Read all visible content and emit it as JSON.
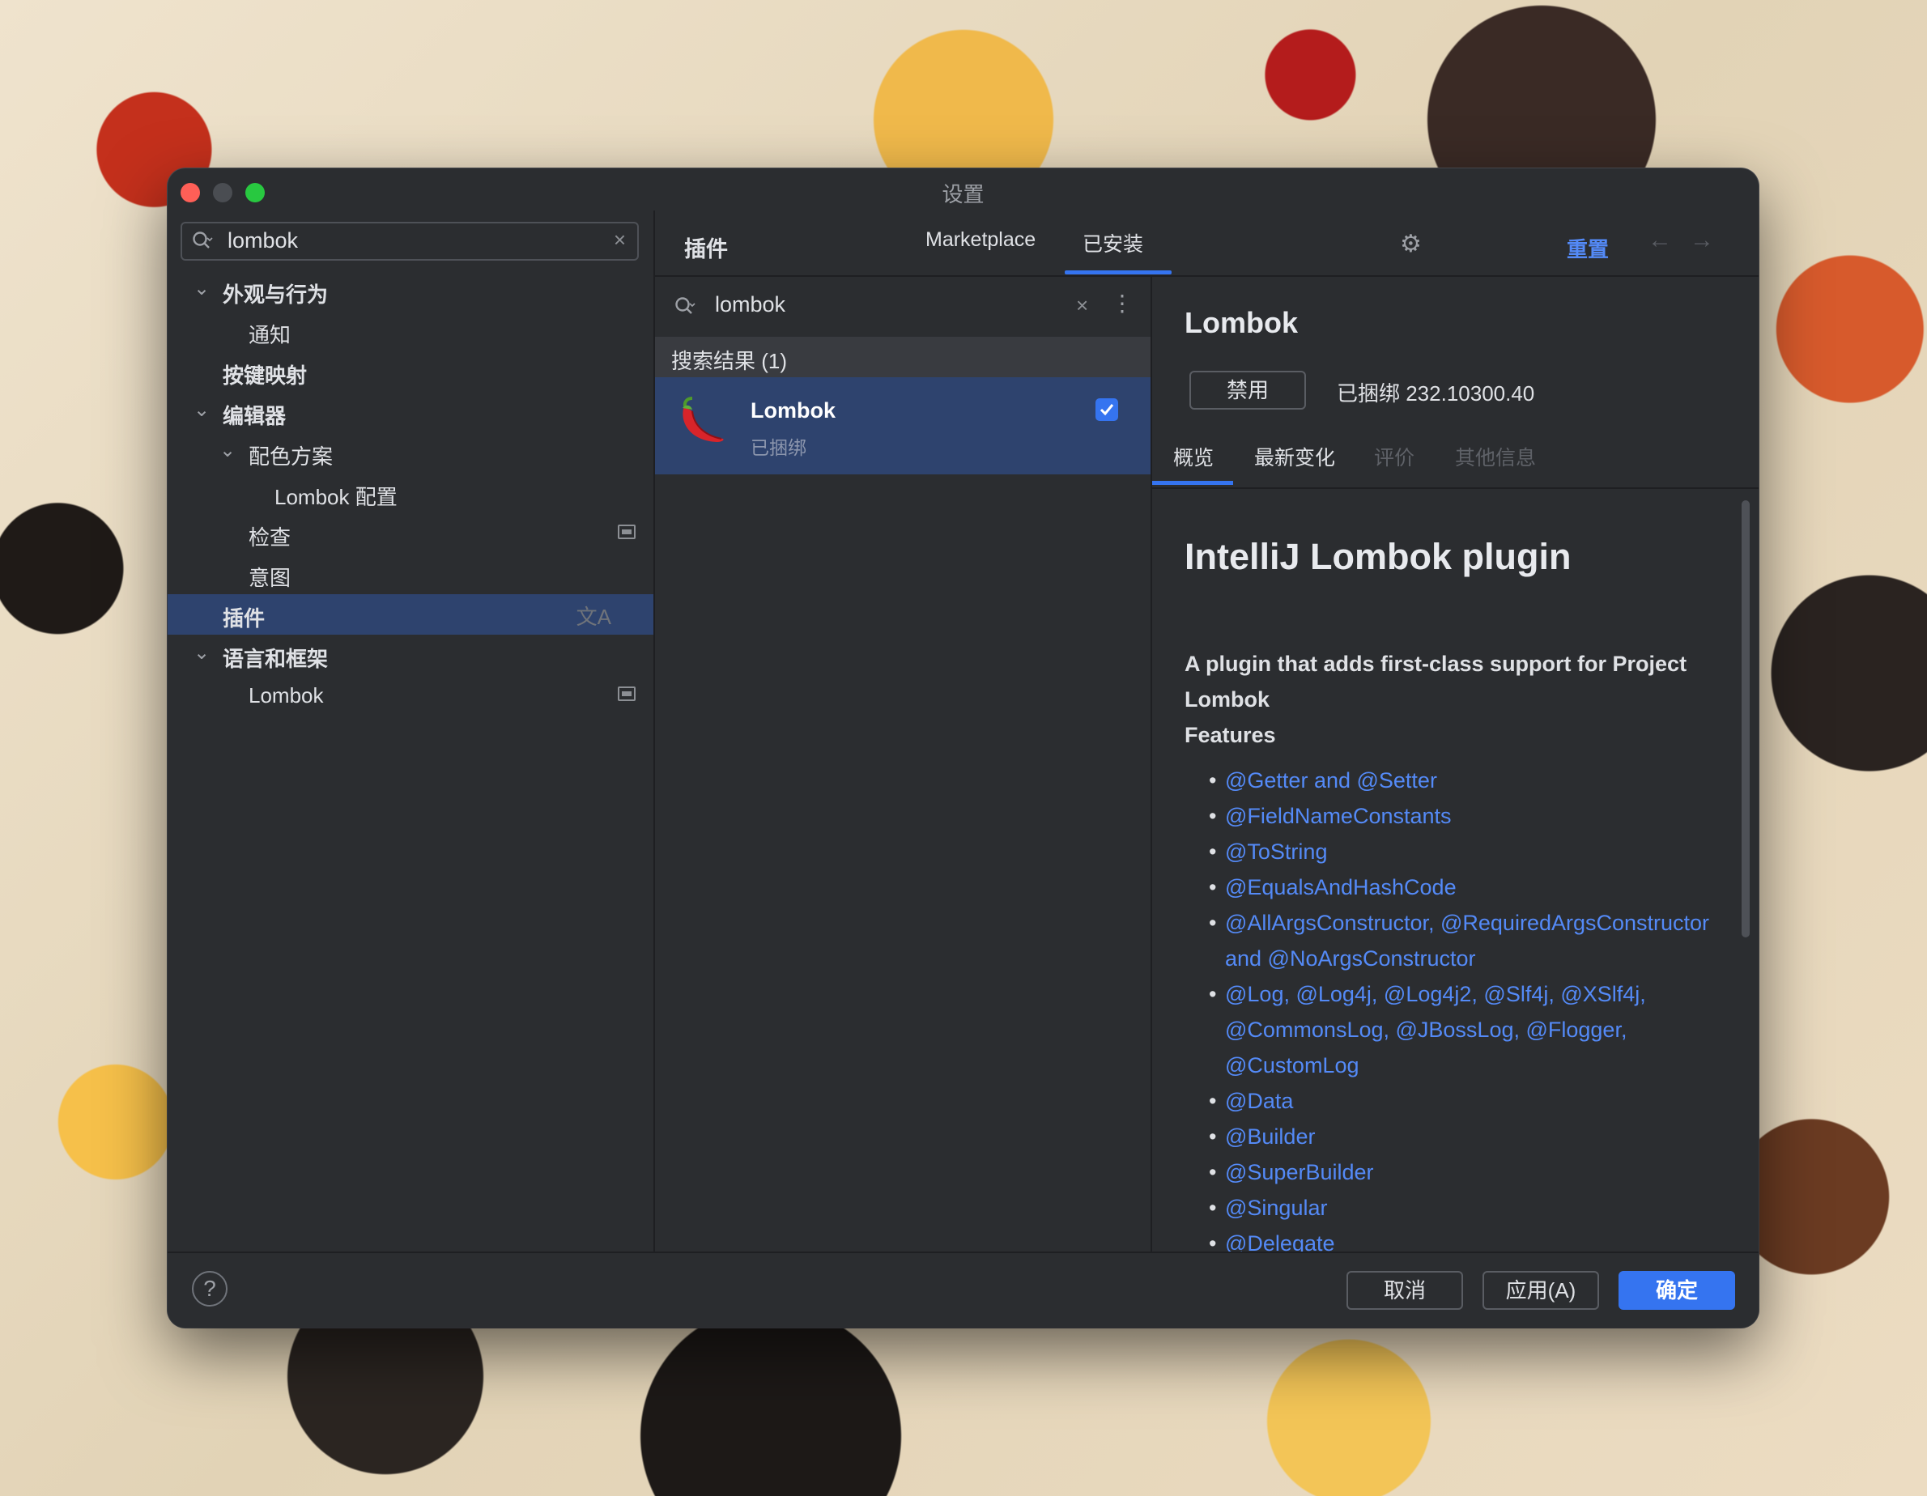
{
  "window": {
    "title": "设置"
  },
  "sidebar": {
    "search": {
      "value": "lombok"
    },
    "items": [
      {
        "label": "外观与行为",
        "level": 0,
        "expanded": true,
        "bold": true
      },
      {
        "label": "通知",
        "level": 1
      },
      {
        "label": "按键映射",
        "level": 0,
        "bold": true
      },
      {
        "label": "编辑器",
        "level": 0,
        "expanded": true,
        "bold": true
      },
      {
        "label": "配色方案",
        "level": 1,
        "expanded": true
      },
      {
        "label": "Lombok 配置",
        "level": 2
      },
      {
        "label": "检查",
        "level": 1
      },
      {
        "label": "意图",
        "level": 1
      },
      {
        "label": "插件",
        "level": 0,
        "bold": true,
        "selected": true
      },
      {
        "label": "语言和框架",
        "level": 0,
        "expanded": true,
        "bold": true
      },
      {
        "label": "Lombok",
        "level": 1
      }
    ]
  },
  "header": {
    "title": "插件",
    "tabs": [
      "Marketplace",
      "已安装"
    ],
    "active_tab": "已安装",
    "reset_label": "重置"
  },
  "plugins": {
    "search": {
      "value": "lombok"
    },
    "results_label": "搜索结果 (1)",
    "list": [
      {
        "name": "Lombok",
        "status": "已捆绑",
        "enabled": true
      }
    ]
  },
  "detail": {
    "title": "Lombok",
    "disable_label": "禁用",
    "bundled_version": "已捆绑 232.10300.40",
    "tabs": [
      "概览",
      "最新变化",
      "评价",
      "其他信息"
    ],
    "heading": "IntelliJ Lombok plugin",
    "description": "A plugin that adds first-class support for Project Lombok",
    "features_label": "Features",
    "features": [
      "@Getter and @Setter",
      "@FieldNameConstants",
      "@ToString",
      "@EqualsAndHashCode",
      "@AllArgsConstructor, @RequiredArgsConstructor and @NoArgsConstructor",
      "@Log, @Log4j, @Log4j2, @Slf4j, @XSlf4j, @CommonsLog, @JBossLog, @Flogger, @CustomLog",
      "@Data",
      "@Builder",
      "@SuperBuilder",
      "@Singular",
      "@Delegate"
    ]
  },
  "footer": {
    "help_label": "?",
    "cancel_label": "取消",
    "apply_label": "应用(A)",
    "ok_label": "确定"
  },
  "colors": {
    "accent": "#3574f0",
    "link": "#548af7",
    "selection": "#2e436e",
    "panel": "#2b2d30"
  }
}
